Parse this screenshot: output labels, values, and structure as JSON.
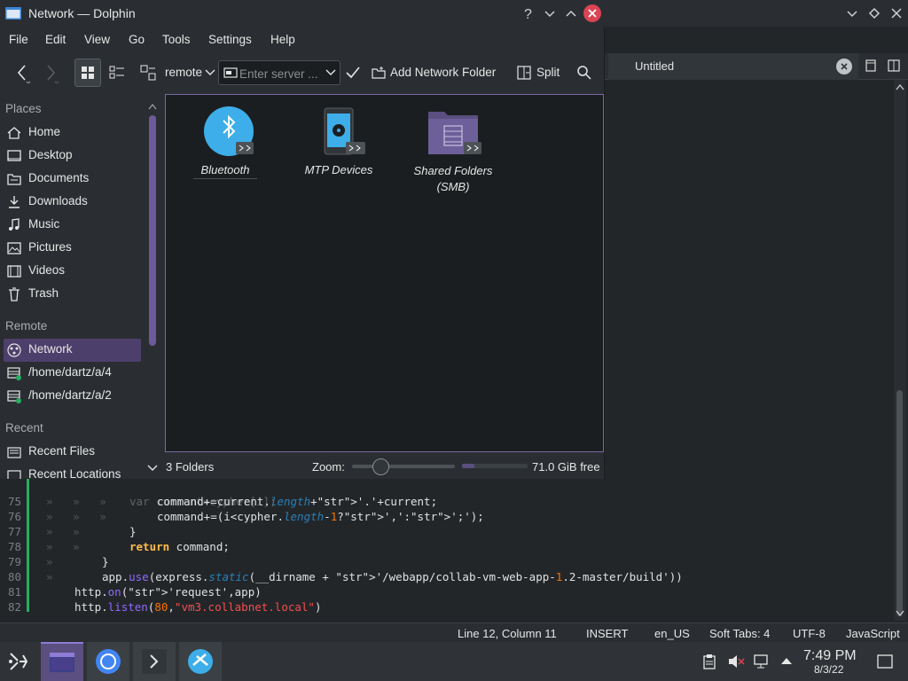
{
  "editor": {
    "tab_title": "Untitled",
    "code_lines": [
      {
        "num": "75",
        "indent": "»   »   »   ",
        "code": "command+=current.length+'.'+current;"
      },
      {
        "num": "76",
        "indent": "»   »   »   ",
        "code": "command+=(i<cypher.length-1?',':';');"
      },
      {
        "num": "77",
        "indent": "»   »   ",
        "code": "}"
      },
      {
        "num": "78",
        "indent": "»   »   ",
        "code": "return command;"
      },
      {
        "num": "79",
        "indent": "»   ",
        "code": "}"
      },
      {
        "num": "80",
        "indent": "»   ",
        "code": "app.use(express.static(__dirname + '/webapp/collab-vm-web-app-1.2-master/build'))"
      },
      {
        "num": "81",
        "indent": "",
        "code": "http.on('request',app)"
      },
      {
        "num": "82",
        "indent": "",
        "code": "http.listen(80,\"vm3.collabnet.local\")"
      }
    ],
    "partial_line": "var current=cypher[i];",
    "status": {
      "position": "Line 12, Column 11",
      "mode": "INSERT",
      "language": "en_US",
      "tabs": "Soft Tabs: 4",
      "encoding": "UTF-8",
      "syntax": "JavaScript"
    }
  },
  "dolphin": {
    "title": "Network — Dolphin",
    "menu": [
      "File",
      "Edit",
      "View",
      "Go",
      "Tools",
      "Settings",
      "Help"
    ],
    "toolbar": {
      "location": "remote",
      "server_placeholder": "Enter server ...",
      "add_network_folder": "Add Network Folder",
      "split": "Split"
    },
    "places": {
      "sections": {
        "places": "Places",
        "remote": "Remote",
        "recent": "Recent"
      },
      "items": {
        "home": "Home",
        "desktop": "Desktop",
        "documents": "Documents",
        "downloads": "Downloads",
        "music": "Music",
        "pictures": "Pictures",
        "videos": "Videos",
        "trash": "Trash",
        "network": "Network",
        "remote4": "/home/dartz/a/4",
        "remote2": "/home/dartz/a/2",
        "recent_files": "Recent Files",
        "recent_locations": "Recent Locations"
      }
    },
    "folders": [
      {
        "name": "Bluetooth"
      },
      {
        "name": "MTP Devices"
      },
      {
        "name": "Shared Folders (SMB)"
      }
    ],
    "status": {
      "count": "3 Folders",
      "zoom_label": "Zoom:",
      "free_space": "71.0 GiB free"
    }
  },
  "taskbar": {
    "time": "7:49 PM",
    "date": "8/3/22"
  },
  "colors": {
    "accent": "#7a68a6",
    "selection": "#4d3f6b",
    "close_button": "#da4453"
  }
}
